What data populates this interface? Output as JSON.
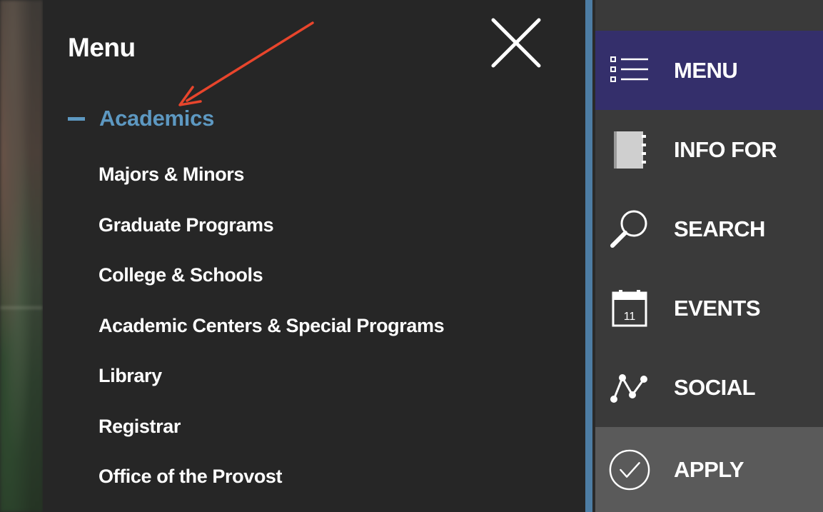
{
  "menu": {
    "title": "Menu",
    "close_icon": "close-x-icon",
    "section": {
      "label": "Academics",
      "expanded": true,
      "items": [
        "Majors & Minors",
        "Graduate Programs",
        "College & Schools",
        "Academic Centers & Special Programs",
        "Library",
        "Registrar",
        "Office of the Provost"
      ]
    }
  },
  "nav": {
    "items": [
      {
        "label": "MENU",
        "icon": "list-icon",
        "active": true
      },
      {
        "label": "INFO FOR",
        "icon": "notebook-icon",
        "active": false
      },
      {
        "label": "SEARCH",
        "icon": "magnifier-icon",
        "active": false
      },
      {
        "label": "EVENTS",
        "icon": "calendar-icon",
        "active": false,
        "icon_text": "11"
      },
      {
        "label": "SOCIAL",
        "icon": "network-icon",
        "active": false
      },
      {
        "label": "APPLY",
        "icon": "check-circle-icon",
        "active": false
      }
    ]
  },
  "colors": {
    "panel_bg": "#262626",
    "accent_blue": "#5d98c1",
    "nav_active_bg": "#342f6b",
    "nav_bg": "#3a3a3a",
    "apply_bg": "#5a5a5a",
    "arrow_red": "#e8452c"
  }
}
